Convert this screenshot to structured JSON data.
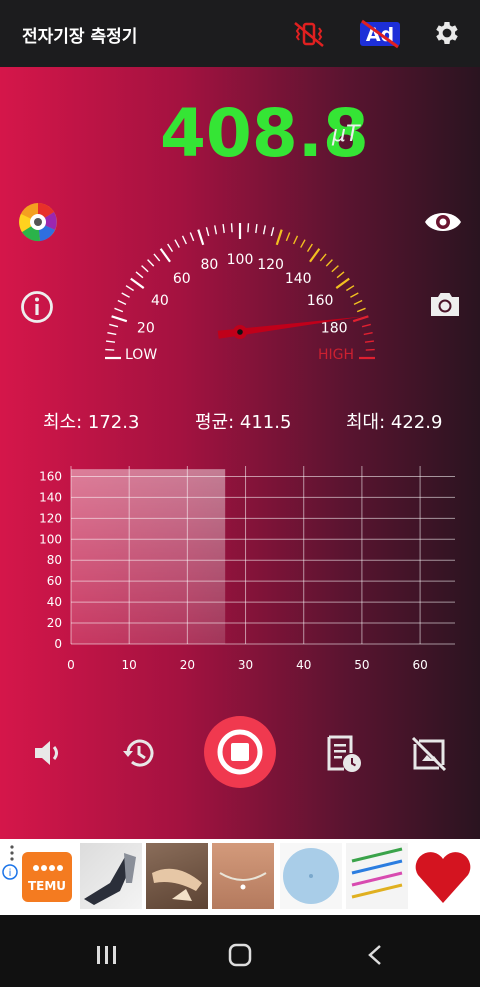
{
  "app": {
    "title": "전자기장 측정기"
  },
  "toolbar": {
    "ad_label": "Ad"
  },
  "meter": {
    "value": "408.8",
    "unit": "μT"
  },
  "gauge": {
    "labels": [
      "20",
      "40",
      "60",
      "80",
      "100",
      "120",
      "140",
      "160",
      "180"
    ],
    "low_label": "LOW",
    "high_label": "HIGH",
    "needle_value": 192
  },
  "stats": {
    "min": "최소: 172.3",
    "avg": "평균: 411.5",
    "max": "최대: 422.9"
  },
  "chart_data": {
    "type": "area",
    "x_ticks": [
      0,
      10,
      20,
      30,
      40,
      50,
      60
    ],
    "y_ticks": [
      0,
      20,
      40,
      60,
      80,
      100,
      120,
      140,
      160
    ],
    "xlim": [
      0,
      66
    ],
    "ylim": [
      0,
      170
    ],
    "grid": true,
    "series": [
      {
        "x": [
          0,
          26.5
        ],
        "y": [
          167,
          167
        ]
      }
    ]
  },
  "controls": {
    "items": [
      "speaker-icon",
      "history-icon",
      "stop-record-button",
      "report-icon",
      "no-screenshot-icon"
    ]
  },
  "ad": {
    "brand": "TEMU",
    "info": "i"
  },
  "colors": {
    "accent_green": "#35e535",
    "record_red": "#f0394f",
    "needle": "#c0001a"
  }
}
